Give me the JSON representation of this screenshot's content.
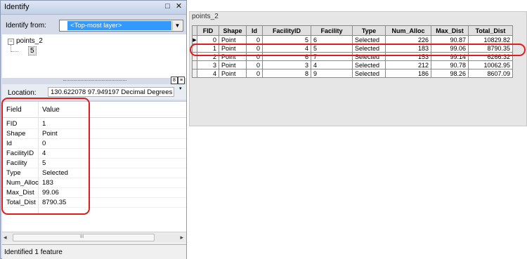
{
  "identify": {
    "title": "Identify",
    "minimize_icon": "□",
    "close_icon": "✕",
    "identify_from_label": "Identify from:",
    "identify_from_value": "<Top-most layer>",
    "tree": {
      "layer": "points_2",
      "feature": "5",
      "toggle": "−"
    },
    "location_label": "Location:",
    "location_value": "130.622078  97.949197 Decimal Degrees",
    "attributes_header": {
      "field": "Field",
      "value": "Value"
    },
    "attributes": [
      {
        "field": "FID",
        "value": "1"
      },
      {
        "field": "Shape",
        "value": "Point"
      },
      {
        "field": "Id",
        "value": "0"
      },
      {
        "field": "FacilityID",
        "value": "4"
      },
      {
        "field": "Facility",
        "value": "5"
      },
      {
        "field": "Type",
        "value": "Selected"
      },
      {
        "field": "Num_Alloc",
        "value": "183"
      },
      {
        "field": "Max_Dist",
        "value": "99.06"
      },
      {
        "field": "Total_Dist",
        "value": "8790.35"
      }
    ],
    "scroll_grip": "III",
    "status": "Identified 1 feature"
  },
  "table": {
    "title": "points_2",
    "columns": [
      "FID",
      "Shape",
      "Id",
      "FacilityID",
      "Facility",
      "Type",
      "Num_Alloc",
      "Max_Dist",
      "Total_Dist"
    ],
    "rows": [
      [
        "0",
        "Point",
        "0",
        "5",
        "6",
        "Selected",
        "226",
        "90.87",
        "10829.82"
      ],
      [
        "1",
        "Point",
        "0",
        "4",
        "5",
        "Selected",
        "183",
        "99.06",
        "8790.35"
      ],
      [
        "2",
        "Point",
        "0",
        "6",
        "7",
        "Selected",
        "153",
        "99.14",
        "6266.32"
      ],
      [
        "3",
        "Point",
        "0",
        "3",
        "4",
        "Selected",
        "212",
        "90.78",
        "10062.95"
      ],
      [
        "4",
        "Point",
        "0",
        "8",
        "9",
        "Selected",
        "186",
        "98.26",
        "8607.09"
      ]
    ],
    "current_row_marker": "▶"
  },
  "colors": {
    "highlight": "#e21b1b",
    "selection": "#3399ff"
  }
}
